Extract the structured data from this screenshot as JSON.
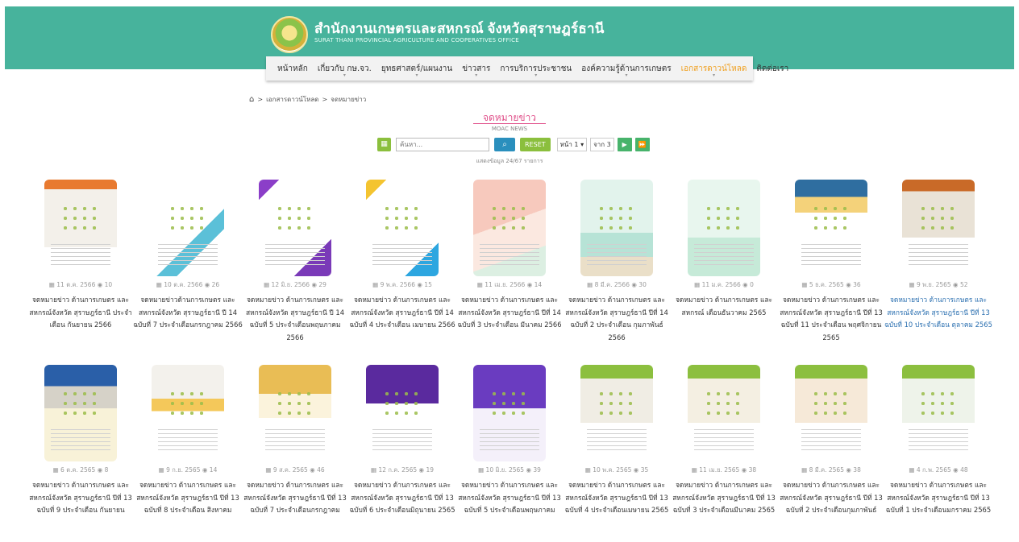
{
  "header": {
    "title": "สำนักงานเกษตรและสหกรณ์ จังหวัดสุราษฎร์ธานี",
    "subtitle": "SURAT THANI PROVINCIAL AGRICULTURE AND COOPERATIVES OFFICE"
  },
  "nav": {
    "items": [
      {
        "label": "หน้าหลัก"
      },
      {
        "label": "เกี่ยวกับ กษ.จว."
      },
      {
        "label": "ยุทธศาสตร์/แผนงาน"
      },
      {
        "label": "ข่าวสาร"
      },
      {
        "label": "การบริการประชาชน"
      },
      {
        "label": "องค์ความรู้ด้านการเกษตร"
      },
      {
        "label": "เอกสารดาวน์โหลด"
      },
      {
        "label": "ติดต่อเรา"
      }
    ],
    "active_index": 6
  },
  "breadcrumb": {
    "sep": ">",
    "items": [
      "เอกสารดาวน์โหลด",
      "จดหมายข่าว"
    ]
  },
  "section": {
    "title": "จดหมายข่าว",
    "subtitle": "MOAC NEWS"
  },
  "toolbar": {
    "search_placeholder": "ค้นหา...",
    "reset_label": "RESET",
    "page_label": "หน้า 1",
    "page_total": "จาก 3",
    "next_icon": "▶",
    "last_icon": "⏩"
  },
  "results": {
    "summary": "แสดงข้อมูล 24/67 รายการ"
  },
  "cards": [
    {
      "date": "11 ต.ค. 2566",
      "views": "10",
      "title": "จดหมายข่าว ด้านการเกษตร และสหกรณ์จังหวัด สุราษฎร์ธานี ประจำเดือน กันยายน 2566",
      "blue": false
    },
    {
      "date": "10 ต.ค. 2566",
      "views": "26",
      "title": "จดหมายข่าวด้านการเกษตร และสหกรณ์จังหวัด สุราษฎร์ธานี ปี 14 ฉบับที่ 7 ประจำเดือนกรกฎาคม 2566",
      "blue": false
    },
    {
      "date": "12 มิ.ย. 2566",
      "views": "29",
      "title": "จดหมายข่าว ด้านการเกษตร และสหกรณ์จังหวัด สุราษฎร์ธานี ปี 14 ฉบับที่ 5 ประจำเดือนพฤษภาคม 2566",
      "blue": false
    },
    {
      "date": "9 พ.ค. 2566",
      "views": "15",
      "title": "จดหมายข่าว ด้านการเกษตร และสหกรณ์จังหวัด สุราษฎร์ธานี ปีที่ 14 ฉบับที่ 4 ประจำเดือน เมษายน 2566",
      "blue": false
    },
    {
      "date": "11 เม.ย. 2566",
      "views": "14",
      "title": "จดหมายข่าว ด้านการเกษตร และสหกรณ์จังหวัด สุราษฎร์ธานี ปีที่ 14 ฉบับที่ 3 ประจำเดือน มีนาคม 2566",
      "blue": false
    },
    {
      "date": "8 มี.ค. 2566",
      "views": "30",
      "title": "จดหมายข่าว ด้านการเกษตร และสหกรณ์จังหวัด สุราษฎร์ธานี ปีที่ 14 ฉบับที่ 2 ประจำเดือน กุมภาพันธ์ 2566",
      "blue": false
    },
    {
      "date": "11 ม.ค. 2566",
      "views": "0",
      "title": "จดหมายข่าว ด้านการเกษตร และสหกรณ์ เดือนธันวาคม 2565",
      "blue": false
    },
    {
      "date": "5 ธ.ค. 2565",
      "views": "36",
      "title": "จดหมายข่าว ด้านการเกษตร และสหกรณ์จังหวัด สุราษฎร์ธานี ปีที่ 13 ฉบับที่ 11 ประจำเดือน พฤศจิกายน 2565",
      "blue": false
    },
    {
      "date": "9 พ.ย. 2565",
      "views": "52",
      "title": "จดหมายข่าว ด้านการเกษตร และสหกรณ์จังหวัด สุราษฎร์ธานี ปีที่ 13 ฉบับที่ 10 ประจำเดือน ตุลาคม 2565",
      "blue": true
    },
    {
      "date": "6 ต.ค. 2565",
      "views": "8",
      "title": "จดหมายข่าว ด้านการเกษตร และสหกรณ์จังหวัด สุราษฎร์ธานี ปีที่ 13 ฉบับที่ 9 ประจำเดือน กันยายน",
      "blue": false
    },
    {
      "date": "9 ก.ย. 2565",
      "views": "14",
      "title": "จดหมายข่าว ด้านการเกษตร และสหกรณ์จังหวัด สุราษฎร์ธานี ปีที่ 13 ฉบับที่ 8 ประจำเดือน สิงหาคม",
      "blue": false
    },
    {
      "date": "9 ส.ค. 2565",
      "views": "46",
      "title": "จดหมายข่าว ด้านการเกษตร และสหกรณ์จังหวัด สุราษฎร์ธานี ปีที่ 13 ฉบับที่ 7 ประจำเดือนกรกฎาคม",
      "blue": false
    },
    {
      "date": "12 ก.ค. 2565",
      "views": "19",
      "title": "จดหมายข่าว ด้านการเกษตร และสหกรณ์จังหวัด สุราษฎร์ธานี ปีที่ 13 ฉบับที่ 6 ประจำเดือนมิถุนายน 2565",
      "blue": false
    },
    {
      "date": "10 มิ.ย. 2565",
      "views": "39",
      "title": "จดหมายข่าว ด้านการเกษตร และสหกรณ์จังหวัด สุราษฎร์ธานี ปีที่ 13 ฉบับที่ 5 ประจำเดือนพฤษภาคม",
      "blue": false
    },
    {
      "date": "10 พ.ค. 2565",
      "views": "35",
      "title": "จดหมายข่าว ด้านการเกษตร และสหกรณ์จังหวัด สุราษฎร์ธานี ปีที่ 13 ฉบับที่ 4 ประจำเดือนเมษายน 2565",
      "blue": false
    },
    {
      "date": "11 เม.ย. 2565",
      "views": "38",
      "title": "จดหมายข่าว ด้านการเกษตร และสหกรณ์จังหวัด สุราษฎร์ธานี ปีที่ 13 ฉบับที่ 3 ประจำเดือนมีนาคม 2565",
      "blue": false
    },
    {
      "date": "8 มี.ค. 2565",
      "views": "38",
      "title": "จดหมายข่าว ด้านการเกษตร และสหกรณ์จังหวัด สุราษฎร์ธานี ปีที่ 13 ฉบับที่ 2 ประจำเดือนกุมภาพันธ์",
      "blue": false
    },
    {
      "date": "4 ก.พ. 2565",
      "views": "48",
      "title": "จดหมายข่าว ด้านการเกษตร และสหกรณ์จังหวัด สุราษฎร์ธานี ปีที่ 13 ฉบับที่ 1 ประจำเดือนมกราคม 2565",
      "blue": false
    }
  ]
}
